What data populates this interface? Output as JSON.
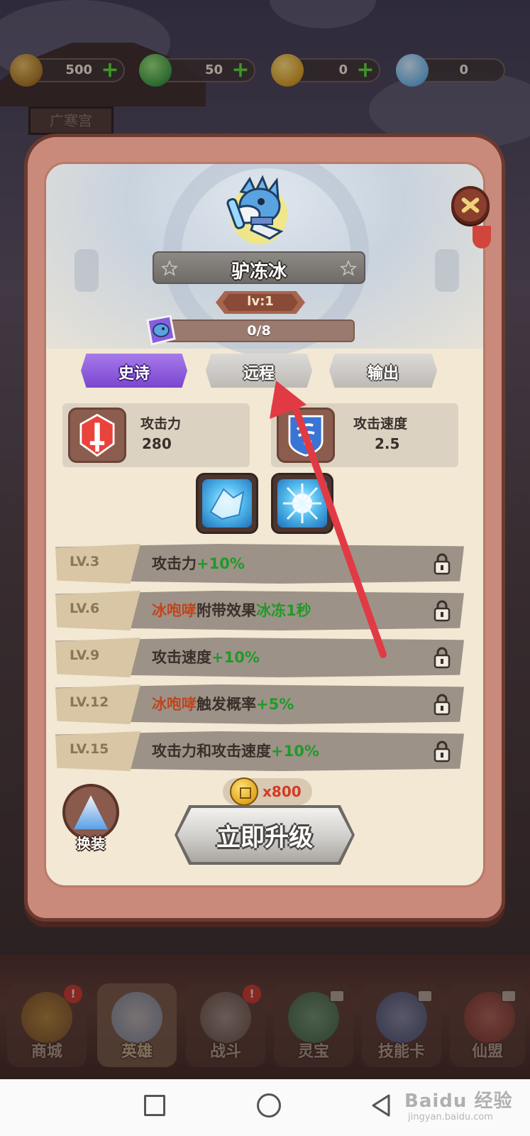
{
  "currency": [
    {
      "icon": "copper-coin-icon",
      "value": "500"
    },
    {
      "icon": "green-jade-icon",
      "value": "50"
    },
    {
      "icon": "gold-lotus-icon",
      "value": "0"
    },
    {
      "icon": "blue-lotus-icon",
      "value": "0"
    }
  ],
  "hero": {
    "name": "驴冻冰",
    "level": "lv:1",
    "shards": "0/8",
    "tags": [
      "史诗",
      "远程",
      "输出"
    ],
    "stats": [
      {
        "label": "攻击力",
        "value": "280",
        "icon": "attack-sword-icon"
      },
      {
        "label": "攻击速度",
        "value": "2.5",
        "icon": "attack-speed-icon"
      }
    ],
    "skills": [
      "ice-crystal-skill-icon",
      "ice-burst-skill-icon"
    ]
  },
  "perks": [
    {
      "lv": "LV.3",
      "parts": [
        [
          "攻击力",
          ""
        ],
        [
          "+10%",
          "green"
        ]
      ]
    },
    {
      "lv": "LV.6",
      "parts": [
        [
          "冰咆哮",
          "red"
        ],
        [
          "附带效果",
          ""
        ],
        [
          "冰冻1秒",
          "green"
        ]
      ]
    },
    {
      "lv": "LV.9",
      "parts": [
        [
          "攻击速度",
          ""
        ],
        [
          "+10%",
          "green"
        ]
      ]
    },
    {
      "lv": "LV.12",
      "parts": [
        [
          "冰咆哮",
          "red"
        ],
        [
          "触发概率",
          ""
        ],
        [
          "+5%",
          "green"
        ]
      ]
    },
    {
      "lv": "LV.15",
      "parts": [
        [
          "攻击力和攻击速度",
          ""
        ],
        [
          "+10%",
          "green"
        ]
      ]
    }
  ],
  "upgrade": {
    "cost": "x800",
    "label": "立即升级"
  },
  "outfit": {
    "label": "换装"
  },
  "nav": [
    {
      "label": "商城",
      "badge": "!",
      "active": false,
      "locked": false
    },
    {
      "label": "英雄",
      "badge": "",
      "active": true,
      "locked": false
    },
    {
      "label": "战斗",
      "badge": "!",
      "active": false,
      "locked": false
    },
    {
      "label": "灵宝",
      "badge": "",
      "active": false,
      "locked": true
    },
    {
      "label": "技能卡",
      "badge": "",
      "active": false,
      "locked": true
    },
    {
      "label": "仙盟",
      "badge": "",
      "active": false,
      "locked": true
    }
  ],
  "background": {
    "sign": "广寒宫"
  },
  "watermark": {
    "main": "Baidu 经验",
    "sub": "jingyan.baidu.com"
  },
  "colors": {
    "epic_tag": "#8b57e0",
    "highlight_red": "#c0461f",
    "highlight_green": "#1f9a2a",
    "arrow": "#e23a44"
  }
}
